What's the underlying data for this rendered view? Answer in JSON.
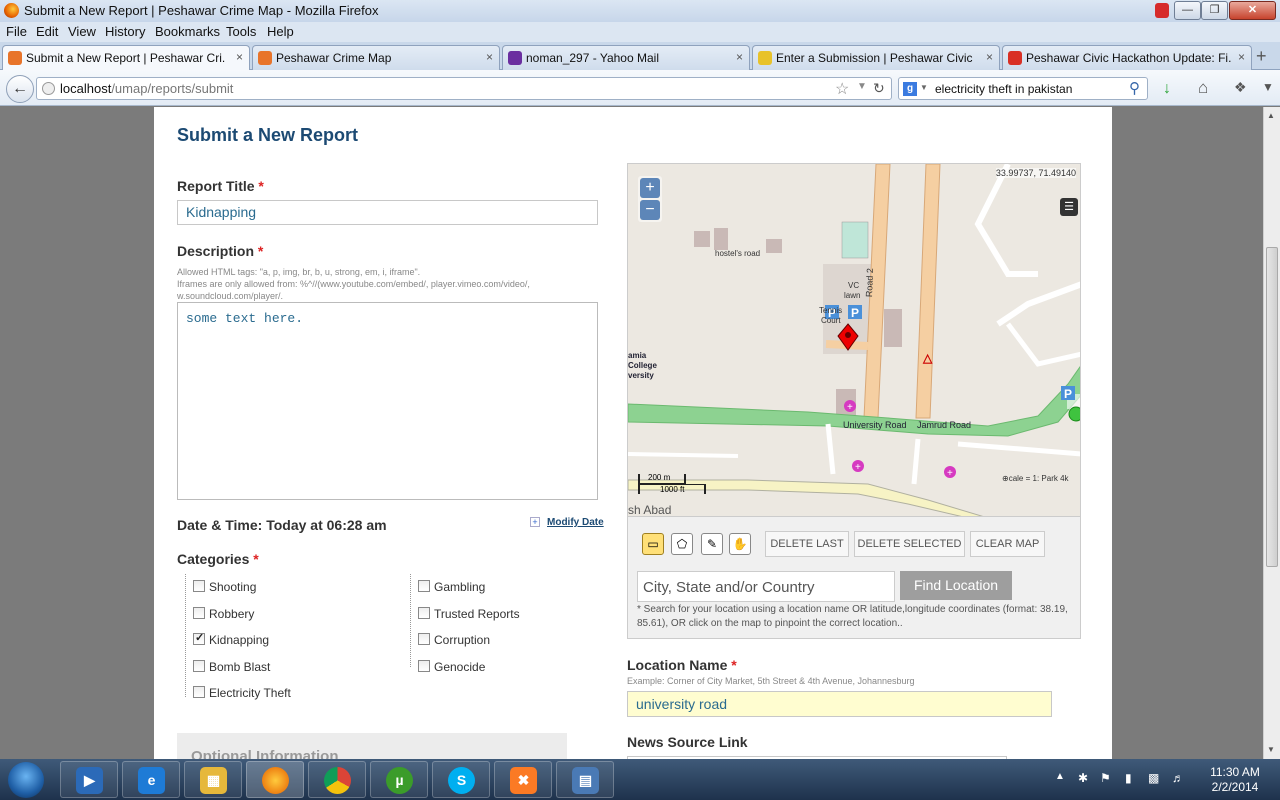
{
  "window": {
    "title": "Submit a New Report | Peshawar Crime Map - Mozilla Firefox",
    "min": "—",
    "max": "❐",
    "close": "✕"
  },
  "menu": [
    "File",
    "Edit",
    "View",
    "History",
    "Bookmarks",
    "Tools",
    "Help"
  ],
  "tabs": [
    {
      "label": "Submit a New Report | Peshawar Cri...",
      "color": "#e8742a",
      "close": "×"
    },
    {
      "label": "Peshawar Crime Map",
      "color": "#e8742a",
      "close": "×"
    },
    {
      "label": "noman_297 - Yahoo Mail",
      "color": "#6b2fa0",
      "close": "×"
    },
    {
      "label": "Enter a Submission | Peshawar Civic ...",
      "color": "#e8c22a",
      "close": "×"
    },
    {
      "label": "Peshawar Civic Hackathon Update: Fi...",
      "color": "#d93025",
      "close": "×"
    }
  ],
  "nav": {
    "url_host": "localhost",
    "url_path": "/umap/reports/submit",
    "search": "electricity theft in pakistan",
    "search_engine": "g",
    "newtab": "+"
  },
  "form": {
    "heading": "Submit a New Report",
    "title_label": "Report Title",
    "title_value": "Kidnapping",
    "required": "*",
    "desc_label": "Description",
    "desc_hint1": "Allowed HTML tags: \"a, p, img, br, b, u, strong, em, i, iframe\".",
    "desc_hint2": "Iframes are only allowed from: %^//(www.youtube.com/embed/, player.vimeo.com/video/,",
    "desc_hint3": "w.soundcloud.com/player/.",
    "desc_value": "some text here.",
    "datetime": "Date & Time: Today at 06:28 am",
    "modify_date": "Modify Date",
    "categories_label": "Categories",
    "cat_left": [
      {
        "label": "Shooting",
        "checked": false
      },
      {
        "label": "Robbery",
        "checked": false
      },
      {
        "label": "Kidnapping",
        "checked": true
      },
      {
        "label": "Bomb Blast",
        "checked": false
      },
      {
        "label": "Electricity Theft",
        "checked": false
      }
    ],
    "cat_right": [
      {
        "label": "Gambling",
        "checked": false
      },
      {
        "label": "Trusted Reports",
        "checked": false
      },
      {
        "label": "Corruption",
        "checked": false
      },
      {
        "label": "Genocide",
        "checked": false
      }
    ],
    "optional": "Optional Information",
    "location_label": "Location Name",
    "location_hint": "Example: Corner of City Market, 5th Street & 4th Avenue, Johannesburg",
    "location_value": "university road",
    "news_label": "News Source Link"
  },
  "map": {
    "coords": "33.99737, 71.49140",
    "zoom_in": "+",
    "zoom_out": "−",
    "labels": {
      "hostels": "hostel's road",
      "vc": "VC",
      "lawn": "lawn",
      "road2": "Road 2",
      "tennis": "Tennis",
      "court": "Court",
      "islamia1": "amia",
      "islamia2": "College",
      "islamia3": "versity",
      "univ_road": "University Road",
      "jamrud": "Jamrud Road",
      "scale_m": "200 m",
      "scale_ft": "1000 ft",
      "bad": "sh Abad",
      "scale_txt": "cale = 1:",
      "park": "Park 4k"
    },
    "buttons": {
      "delete_last": "DELETE LAST",
      "delete_selected": "DELETE SELECTED",
      "clear_map": "CLEAR MAP"
    },
    "loc_placeholder": "City, State and/or Country",
    "find": "Find Location",
    "loc_hint": "* Search for your location using a location name OR latitude,longitude coordinates (format: 38.19, 85.61), OR click on the map to pinpoint the correct location.."
  },
  "taskbar": {
    "time": "11:30 AM",
    "date": "2/2/2014"
  }
}
